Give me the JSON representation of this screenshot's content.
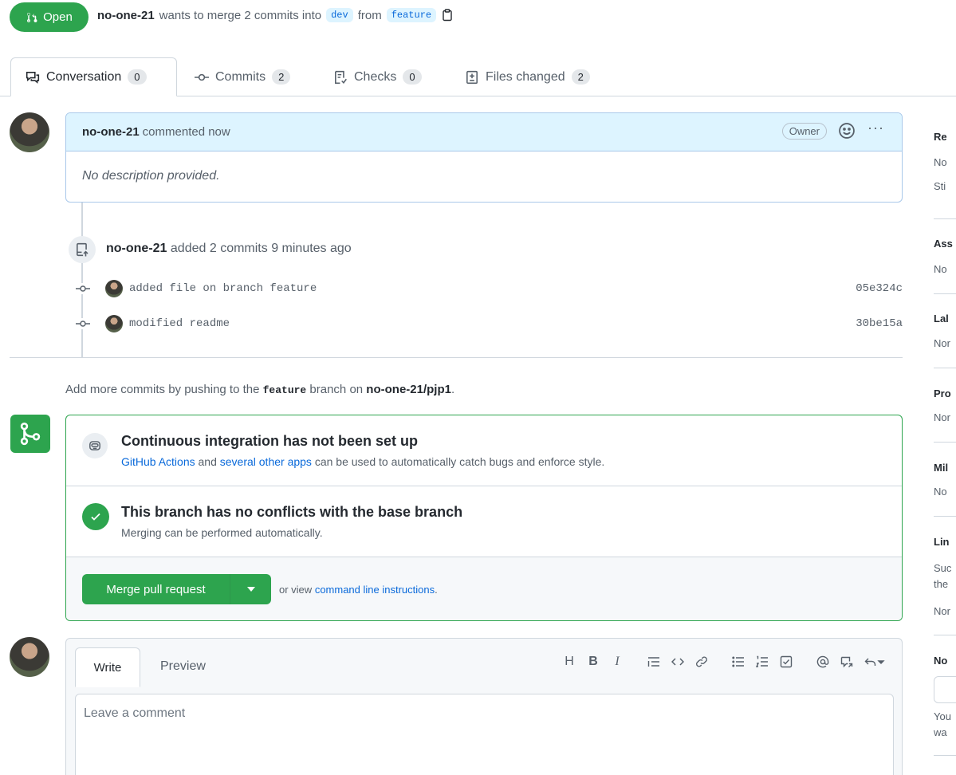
{
  "header": {
    "status_label": "Open",
    "author": "no-one-21",
    "summary_text": "wants to merge 2 commits into",
    "base_branch": "dev",
    "from_text": "from",
    "head_branch": "feature"
  },
  "tabs": [
    {
      "label": "Conversation",
      "count": "0"
    },
    {
      "label": "Commits",
      "count": "2"
    },
    {
      "label": "Checks",
      "count": "0"
    },
    {
      "label": "Files changed",
      "count": "2"
    }
  ],
  "comment": {
    "author": "no-one-21",
    "action": "commented now",
    "badge": "Owner",
    "body": "No description provided."
  },
  "timeline_event": {
    "author": "no-one-21",
    "text": "added 2 commits 9 minutes ago"
  },
  "commits": [
    {
      "message": "added file on branch feature",
      "sha": "05e324c"
    },
    {
      "message": "modified readme",
      "sha": "30be15a"
    }
  ],
  "hint": {
    "prefix": "Add more commits by pushing to the",
    "branch": "feature",
    "middle": "branch on",
    "repo": "no-one-21/pjp1",
    "suffix": "."
  },
  "merge_box": {
    "ci_title": "Continuous integration has not been set up",
    "ci_link1": "GitHub Actions",
    "ci_and": "and",
    "ci_link2": "several other apps",
    "ci_rest": "can be used to automatically catch bugs and enforce style.",
    "conflict_title": "This branch has no conflicts with the base branch",
    "conflict_sub": "Merging can be performed automatically.",
    "merge_button": "Merge pull request",
    "alt_prefix": "or view",
    "alt_link": "command line instructions",
    "alt_suffix": "."
  },
  "new_comment": {
    "write_tab": "Write",
    "preview_tab": "Preview",
    "placeholder": "Leave a comment",
    "toolbar_icons": [
      "heading-icon",
      "bold-icon",
      "italic-icon",
      "quote-icon",
      "code-icon",
      "link-icon",
      "unordered-list-icon",
      "ordered-list-icon",
      "task-list-icon",
      "mention-icon",
      "reference-icon",
      "reply-icon"
    ]
  },
  "sidebar": {
    "sections": [
      {
        "label": "Re",
        "values": [
          "No",
          "Sti"
        ]
      },
      {
        "label": "Ass",
        "values": [
          "No"
        ]
      },
      {
        "label": "Lal",
        "values": [
          "Nor"
        ]
      },
      {
        "label": "Pro",
        "values": [
          "Nor"
        ]
      },
      {
        "label": "Mil",
        "values": [
          "No"
        ]
      },
      {
        "label": "Lin",
        "values": [
          "Suc",
          "the",
          "Nor"
        ]
      },
      {
        "label": "No",
        "values": [
          "You",
          "wa"
        ]
      }
    ]
  },
  "colors": {
    "green": "#2da44e",
    "blue_link": "#0969da",
    "comment_header_bg": "#ddf4ff"
  }
}
